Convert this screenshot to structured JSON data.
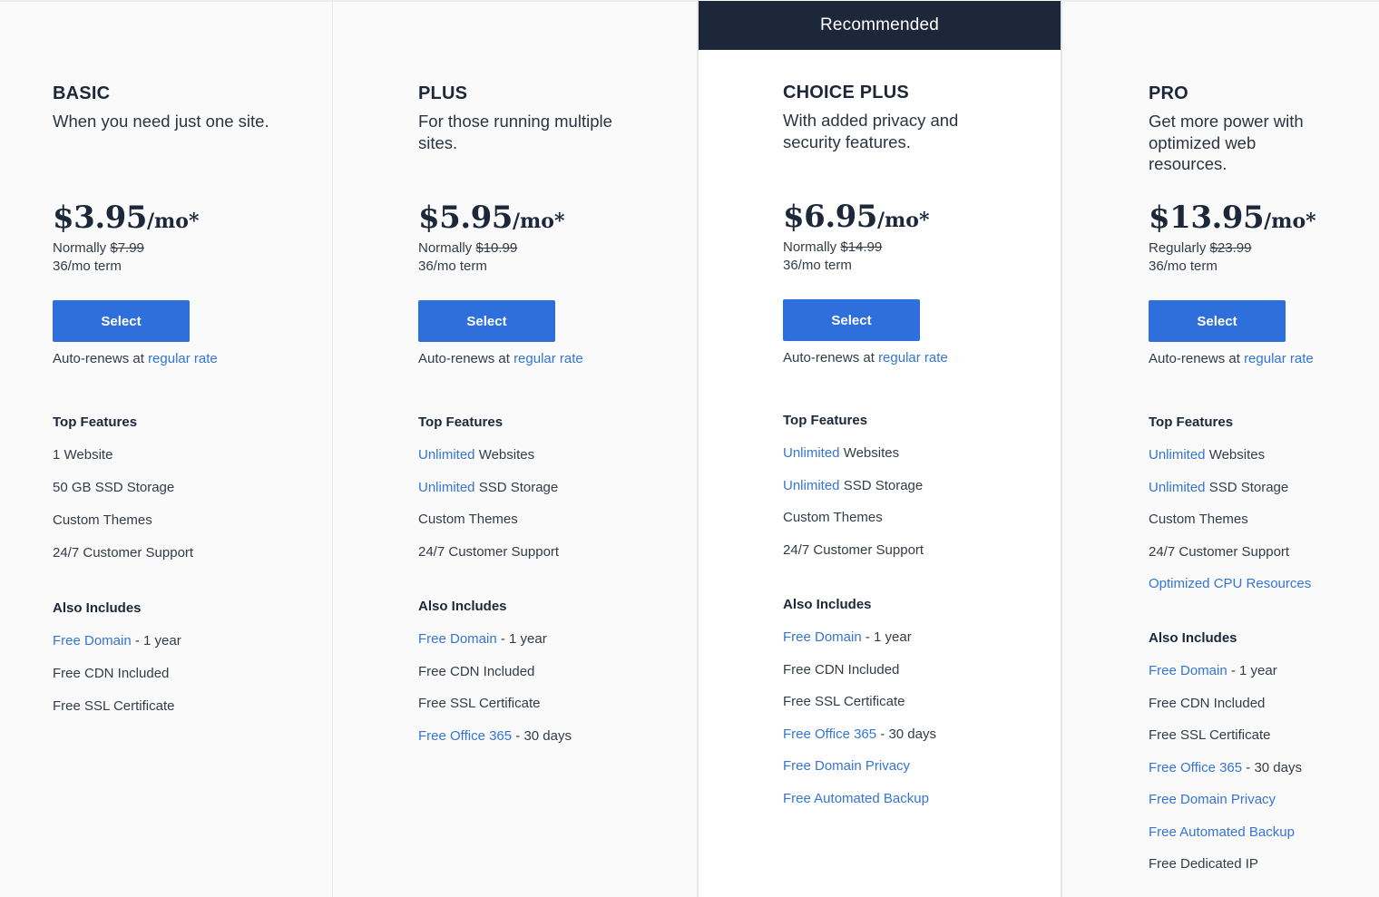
{
  "recommended_label": "Recommended",
  "plans": [
    {
      "name": "BASIC",
      "tagline": "When you need just one site.",
      "price": "$3.95",
      "per": "/mo*",
      "normal_label": "Normally",
      "normal_price": "$7.99",
      "term": "36/mo term",
      "select_label": "Select",
      "renew_text": "Auto-renews at ",
      "renew_link": "regular rate",
      "top_features_title": "Top Features",
      "top_features": [
        {
          "link": "",
          "text": "1 Website"
        },
        {
          "link": "",
          "text": "50 GB SSD Storage"
        },
        {
          "link": "",
          "text": "Custom Themes"
        },
        {
          "link": "",
          "text": "24/7 Customer Support"
        }
      ],
      "also_title": "Also Includes",
      "also": [
        {
          "link": "Free Domain",
          "text": " - 1 year"
        },
        {
          "link": "",
          "text": "Free CDN Included"
        },
        {
          "link": "",
          "text": "Free SSL Certificate"
        }
      ]
    },
    {
      "name": "PLUS",
      "tagline": "For those running multiple sites.",
      "price": "$5.95",
      "per": "/mo*",
      "normal_label": "Normally",
      "normal_price": "$10.99",
      "term": "36/mo term",
      "select_label": "Select",
      "renew_text": "Auto-renews at ",
      "renew_link": "regular rate",
      "top_features_title": "Top Features",
      "top_features": [
        {
          "link": "Unlimited",
          "text": " Websites"
        },
        {
          "link": "Unlimited",
          "text": " SSD Storage"
        },
        {
          "link": "",
          "text": "Custom Themes"
        },
        {
          "link": "",
          "text": "24/7 Customer Support"
        }
      ],
      "also_title": "Also Includes",
      "also": [
        {
          "link": "Free Domain",
          "text": " - 1 year"
        },
        {
          "link": "",
          "text": "Free CDN Included"
        },
        {
          "link": "",
          "text": "Free SSL Certificate"
        },
        {
          "link": "Free Office 365",
          "text": " - 30 days"
        }
      ]
    },
    {
      "name": "CHOICE PLUS",
      "tagline": "With added privacy and security features.",
      "price": "$6.95",
      "per": "/mo*",
      "normal_label": "Normally",
      "normal_price": "$14.99",
      "term": "36/mo term",
      "select_label": "Select",
      "renew_text": "Auto-renews at ",
      "renew_link": "regular rate",
      "top_features_title": "Top Features",
      "top_features": [
        {
          "link": "Unlimited",
          "text": " Websites"
        },
        {
          "link": "Unlimited",
          "text": " SSD Storage"
        },
        {
          "link": "",
          "text": "Custom Themes"
        },
        {
          "link": "",
          "text": "24/7 Customer Support"
        }
      ],
      "also_title": "Also Includes",
      "also": [
        {
          "link": "Free Domain",
          "text": " - 1 year"
        },
        {
          "link": "",
          "text": "Free CDN Included"
        },
        {
          "link": "",
          "text": "Free SSL Certificate"
        },
        {
          "link": "Free Office 365",
          "text": " - 30 days"
        },
        {
          "link": "Free Domain Privacy",
          "text": ""
        },
        {
          "link": "Free Automated Backup",
          "text": ""
        }
      ]
    },
    {
      "name": "PRO",
      "tagline": "Get more power with optimized web resources.",
      "price": "$13.95",
      "per": "/mo*",
      "normal_label": "Regularly",
      "normal_price": "$23.99",
      "term": "36/mo term",
      "select_label": "Select",
      "renew_text": "Auto-renews at ",
      "renew_link": "regular rate",
      "top_features_title": "Top Features",
      "top_features": [
        {
          "link": "Unlimited",
          "text": " Websites"
        },
        {
          "link": "Unlimited",
          "text": " SSD Storage"
        },
        {
          "link": "",
          "text": "Custom Themes"
        },
        {
          "link": "",
          "text": "24/7 Customer Support"
        },
        {
          "link": "Optimized CPU Resources",
          "text": ""
        }
      ],
      "also_title": "Also Includes",
      "also": [
        {
          "link": "Free Domain",
          "text": " - 1 year"
        },
        {
          "link": "",
          "text": "Free CDN Included"
        },
        {
          "link": "",
          "text": "Free SSL Certificate"
        },
        {
          "link": "Free Office 365",
          "text": " - 30 days"
        },
        {
          "link": "Free Domain Privacy",
          "text": ""
        },
        {
          "link": "Free Automated Backup",
          "text": ""
        },
        {
          "link": "",
          "text": "Free Dedicated IP"
        }
      ]
    }
  ]
}
